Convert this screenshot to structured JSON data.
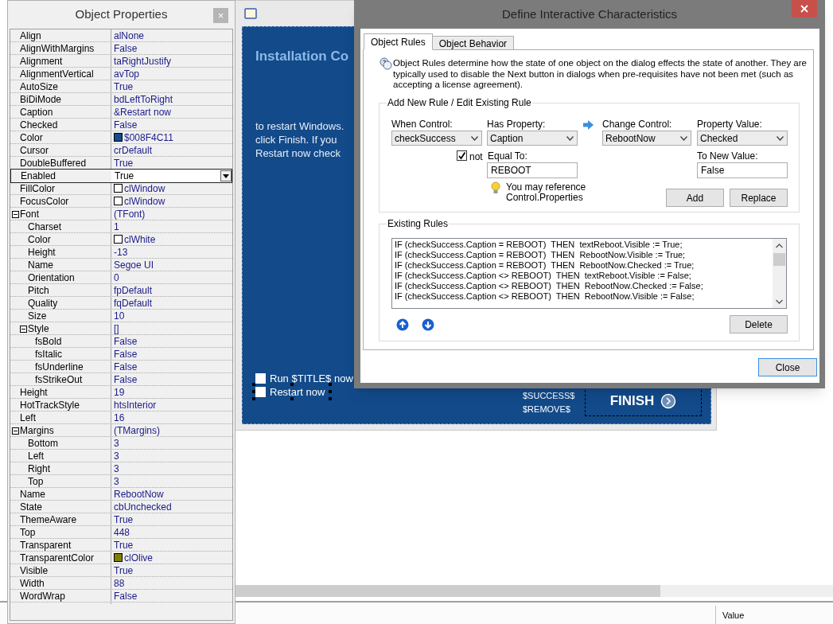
{
  "properties_panel": {
    "title": "Object Properties",
    "close": "×",
    "rows": [
      {
        "name": "Align",
        "value": "alNone",
        "selected": false
      },
      {
        "name": "AlignWithMargins",
        "value": "False",
        "selected": false
      },
      {
        "name": "Alignment",
        "value": "taRightJustify",
        "selected": false
      },
      {
        "name": "AlignmentVertical",
        "value": "avTop",
        "selected": false
      },
      {
        "name": "AutoSize",
        "value": "True",
        "selected": false
      },
      {
        "name": "BiDiMode",
        "value": "bdLeftToRight",
        "selected": false
      },
      {
        "name": "Caption",
        "value": "&Restart now",
        "selected": false
      },
      {
        "name": "Checked",
        "value": "False",
        "selected": false
      },
      {
        "name": "Color",
        "value": "$008F4C11",
        "color": "#114c8f",
        "selected": false
      },
      {
        "name": "Cursor",
        "value": "crDefault",
        "selected": false
      },
      {
        "name": "DoubleBuffered",
        "value": "True",
        "selected": false
      },
      {
        "name": "Enabled",
        "value": "True",
        "selected": true
      },
      {
        "name": "FillColor",
        "value": "clWindow",
        "color": "#ffffff",
        "selected": false
      },
      {
        "name": "FocusColor",
        "value": "clWindow",
        "color": "#ffffff",
        "selected": false
      },
      {
        "name": "Font",
        "value": "(TFont)",
        "expanded": true,
        "selected": false,
        "children": [
          {
            "name": "Charset",
            "value": "1",
            "selected": false
          },
          {
            "name": "Color",
            "value": "clWhite",
            "color": "#ffffff",
            "selected": false
          },
          {
            "name": "Height",
            "value": "-13",
            "selected": false
          },
          {
            "name": "Name",
            "value": "Segoe UI",
            "selected": false
          },
          {
            "name": "Orientation",
            "value": "0",
            "selected": false
          },
          {
            "name": "Pitch",
            "value": "fpDefault",
            "selected": false
          },
          {
            "name": "Quality",
            "value": "fqDefault",
            "selected": false
          },
          {
            "name": "Size",
            "value": "10",
            "selected": false
          },
          {
            "name": "Style",
            "value": "[]",
            "expanded": true,
            "selected": false,
            "children": [
              {
                "name": "fsBold",
                "value": "False",
                "selected": false
              },
              {
                "name": "fsItalic",
                "value": "False",
                "selected": false
              },
              {
                "name": "fsUnderline",
                "value": "False",
                "selected": false
              },
              {
                "name": "fsStrikeOut",
                "value": "False",
                "selected": false
              }
            ]
          }
        ]
      },
      {
        "name": "Height",
        "value": "19",
        "selected": false
      },
      {
        "name": "HotTrackStyle",
        "value": "htsInterior",
        "selected": false
      },
      {
        "name": "Left",
        "value": "16",
        "selected": false
      },
      {
        "name": "Margins",
        "value": "(TMargins)",
        "expanded": true,
        "selected": false,
        "children": [
          {
            "name": "Bottom",
            "value": "3",
            "selected": false
          },
          {
            "name": "Left",
            "value": "3",
            "selected": false
          },
          {
            "name": "Right",
            "value": "3",
            "selected": false
          },
          {
            "name": "Top",
            "value": "3",
            "selected": false
          }
        ]
      },
      {
        "name": "Name",
        "value": "RebootNow",
        "selected": false
      },
      {
        "name": "State",
        "value": "cbUnchecked",
        "selected": false
      },
      {
        "name": "ThemeAware",
        "value": "True",
        "selected": false
      },
      {
        "name": "Top",
        "value": "448",
        "selected": false
      },
      {
        "name": "Transparent",
        "value": "True",
        "selected": false
      },
      {
        "name": "TransparentColor",
        "value": "clOlive",
        "color": "#808000",
        "selected": false
      },
      {
        "name": "Visible",
        "value": "True",
        "selected": false
      },
      {
        "name": "Width",
        "value": "88",
        "selected": false
      },
      {
        "name": "WordWrap",
        "value": "False",
        "selected": false
      }
    ]
  },
  "designer": {
    "heading": "Installation Co",
    "body_lines": [
      "to restart Windows.",
      "click Finish. If you",
      "Restart now check"
    ],
    "checkboxes": [
      {
        "label": "Run $TITLE$ now",
        "checked": false,
        "selected": false
      },
      {
        "label": "Restart now",
        "checked": false,
        "selected": true
      }
    ],
    "variables": [
      "$SUCCESS$",
      "$REMOVE$"
    ],
    "finish_button": "FINISH"
  },
  "dialog": {
    "title": "Define Interactive Characteristics",
    "tabs": [
      {
        "label": "Object Rules",
        "selected": true
      },
      {
        "label": "Object Behavior",
        "selected": false
      }
    ],
    "description": "Object Rules determine how the state of one object on the dialog effects the state of another. They are typically used to disable the Next button in dialogs when pre-requisites have not been met (such as accepting a license agreement).",
    "rule_group": {
      "title": "Add New Rule / Edit Existing Rule",
      "when_control": {
        "label": "When Control:",
        "value": "checkSuccess"
      },
      "has_property": {
        "label": "Has Property:",
        "value": "Caption"
      },
      "change_control": {
        "label": "Change Control:",
        "value": "RebootNow"
      },
      "property_value": {
        "label": "Property Value:",
        "value": "Checked"
      },
      "not": {
        "label": "not",
        "checked": true
      },
      "equal_to": {
        "label": "Equal To:",
        "value": "REBOOT"
      },
      "to_new_value": {
        "label": "To New Value:",
        "value": "False"
      },
      "hint": "You may reference Control.Properties",
      "buttons": [
        "Add",
        "Replace"
      ]
    },
    "existing_rules": {
      "title": "Existing Rules",
      "lines": [
        "IF (checkSuccess.Caption = REBOOT)  THEN  textReboot.Visible := True;",
        "IF (checkSuccess.Caption = REBOOT)  THEN  RebootNow.Visible := True;",
        "IF (checkSuccess.Caption = REBOOT)  THEN  RebootNow.Checked := True;",
        "IF (checkSuccess.Caption <> REBOOT)  THEN  textReboot.Visible := False;",
        "IF (checkSuccess.Caption <> REBOOT)  THEN  RebootNow.Checked := False;",
        "IF (checkSuccess.Caption <> REBOOT)  THEN  RebootNow.Visible := False;"
      ],
      "delete_button": "Delete"
    },
    "close_button": "Close"
  },
  "bottom_panel": {
    "column": "Value"
  }
}
